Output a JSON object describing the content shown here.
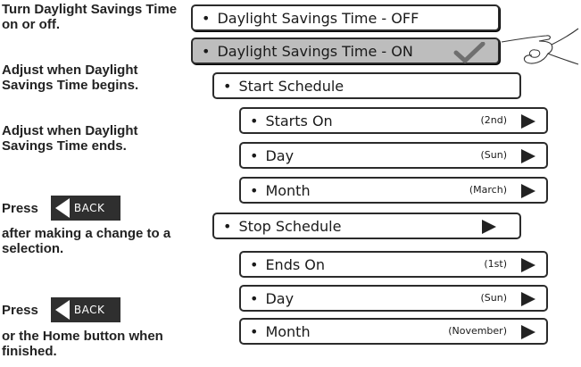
{
  "instructions": {
    "toggle": "Turn Daylight Savings Time on or off.",
    "begins": "Adjust when Daylight Savings Time begins.",
    "ends": "Adjust when Daylight Savings Time ends.",
    "press1": "Press",
    "after_change": "after making a change to a selection.",
    "press2": "Press",
    "when_finished": "or the Home button when finished."
  },
  "back_button": {
    "label": "BACK",
    "icon": "left-arrow-icon"
  },
  "menu": {
    "dst_off": {
      "label": "Daylight Savings Time - OFF"
    },
    "dst_on": {
      "label": "Daylight Savings Time - ON",
      "selected": true,
      "icon": "checkmark-icon"
    },
    "start_schedule": {
      "label": "Start Schedule",
      "items": [
        {
          "label": "Starts On",
          "value": "(2nd)"
        },
        {
          "label": "Day",
          "value": "(Sun)"
        },
        {
          "label": "Month",
          "value": "(March)"
        }
      ]
    },
    "stop_schedule": {
      "label": "Stop Schedule",
      "items": [
        {
          "label": "Ends On",
          "value": "(1st)"
        },
        {
          "label": "Day",
          "value": "(Sun)"
        },
        {
          "label": "Month",
          "value": "(November)"
        }
      ]
    }
  },
  "colors": {
    "selected_bg": "#bdbdbd",
    "border": "#2b2b2b",
    "button_bg": "#2f2f2f"
  },
  "icons": {
    "pointer": "pointing-hand-icon",
    "arrow": "right-triangle-icon"
  }
}
